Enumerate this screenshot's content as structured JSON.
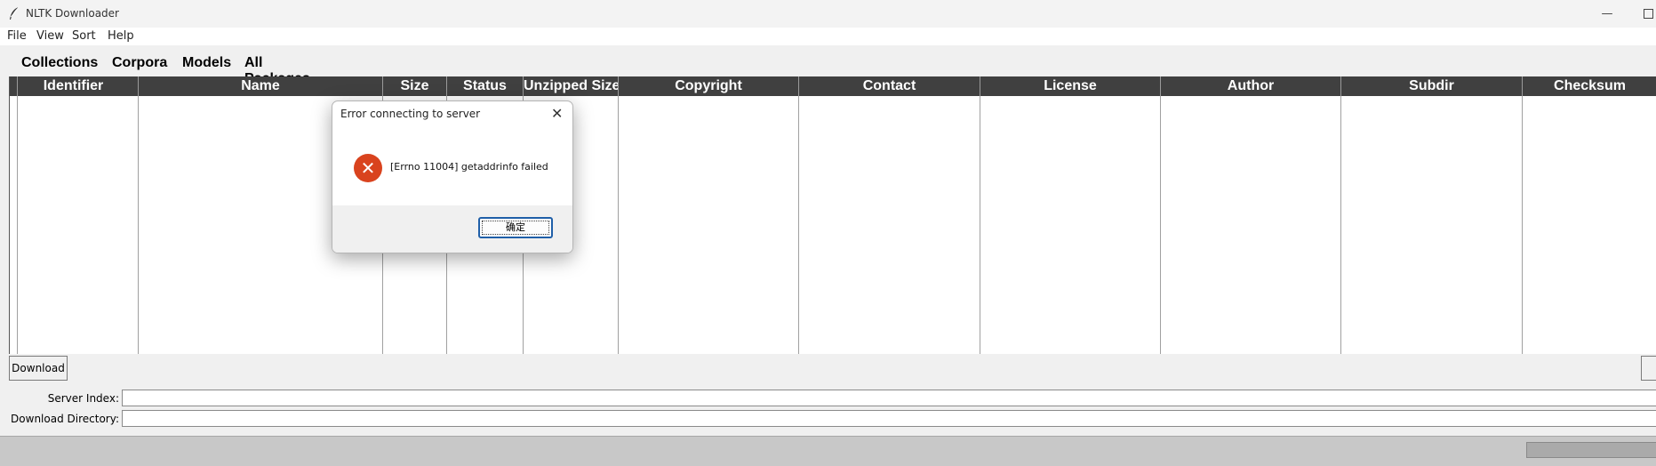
{
  "window": {
    "title": "NLTK Downloader",
    "minimize_symbol": "—"
  },
  "menu": [
    "File",
    "View",
    "Sort",
    "Help"
  ],
  "tabs": [
    "Collections",
    "Corpora",
    "Models",
    "All Packages"
  ],
  "table": {
    "columns": [
      "Identifier",
      "Name",
      "Size",
      "Status",
      "Unzipped Size",
      "Copyright",
      "Contact",
      "License",
      "Author",
      "Subdir",
      "Checksum"
    ],
    "rows": []
  },
  "buttons": {
    "download": "Download"
  },
  "fields": {
    "server_index_label": "Server Index:",
    "server_index_value": "",
    "download_directory_label": "Download Directory:",
    "download_directory_value": ""
  },
  "dialog": {
    "title": "Error connecting to server",
    "close_symbol": "✕",
    "icon": "error-icon",
    "icon_symbol": "✕",
    "message": "[Errno 11004] getaddrinfo failed",
    "ok_label": "确定",
    "accent_color": "#d9431e"
  }
}
